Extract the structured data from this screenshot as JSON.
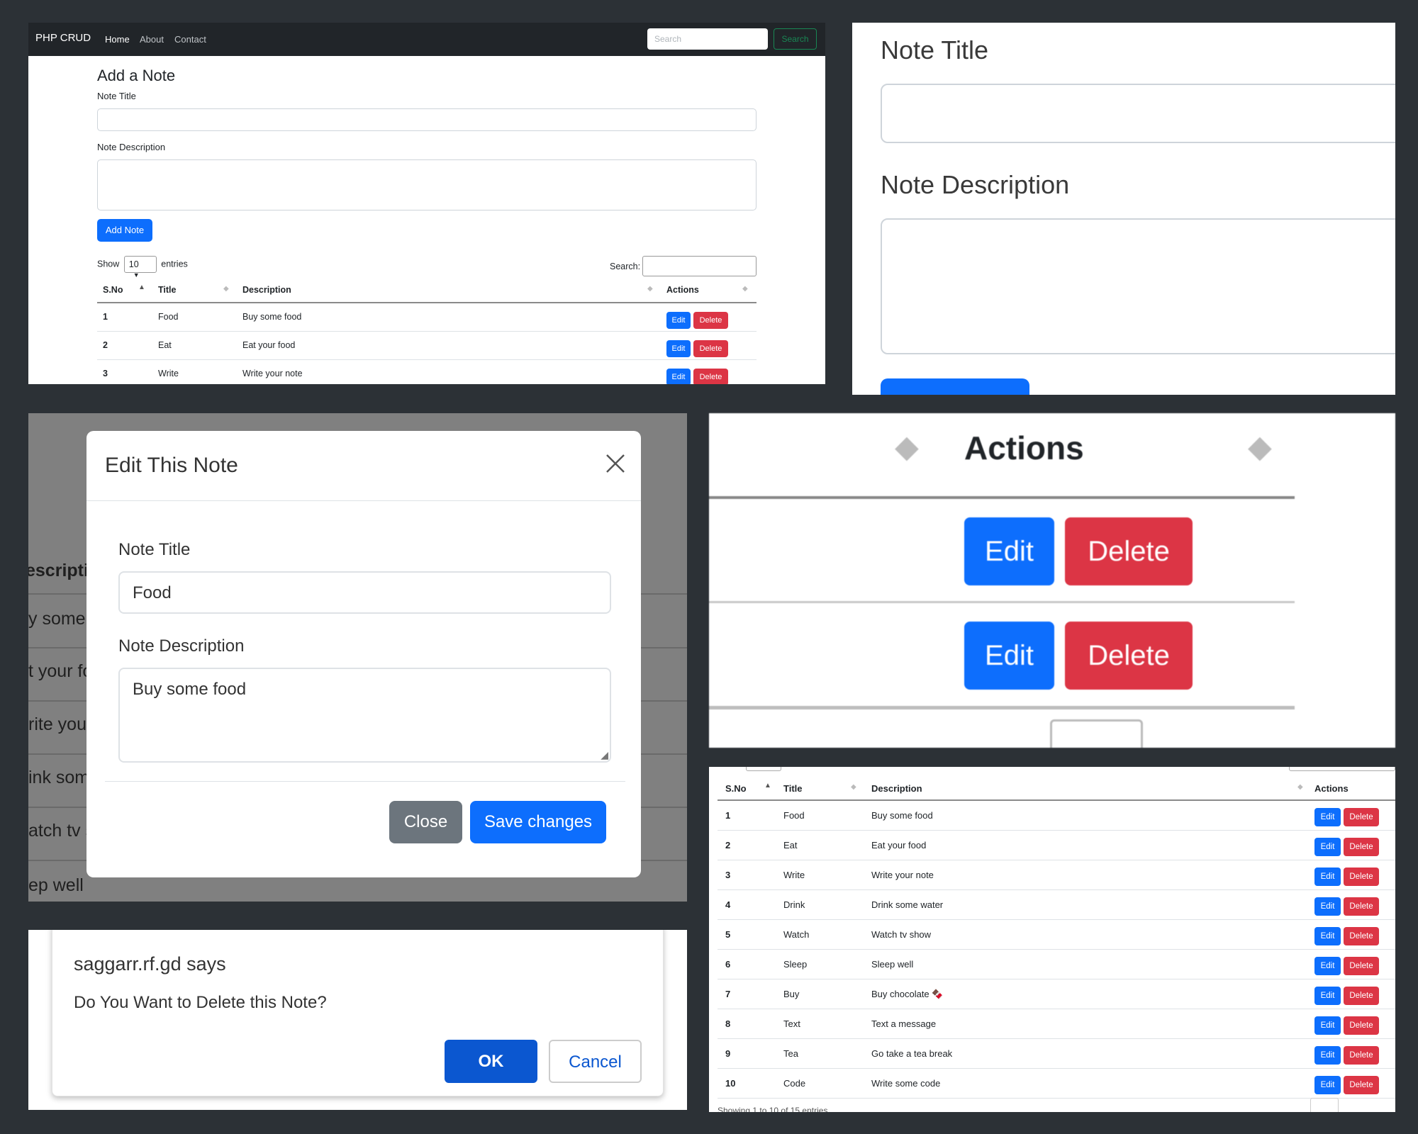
{
  "colors": {
    "primary": "#0d6efd",
    "danger": "#dc3545",
    "secondary": "#6c757d",
    "dark": "#212529",
    "backdrop": "#808080"
  },
  "navbar": {
    "brand": "PHP CRUD",
    "links": [
      "Home",
      "About",
      "Contact"
    ],
    "active_link": "Home",
    "search_placeholder": "Search",
    "search_button": "Search"
  },
  "add_form": {
    "heading": "Add a Note",
    "title_label": "Note Title",
    "desc_label": "Note Description",
    "submit_label": "Add Note"
  },
  "table_controls": {
    "show_label": "Show",
    "entries_value": "10",
    "entries_label": "entries",
    "search_label": "Search:"
  },
  "table": {
    "headers": [
      "S.No",
      "Title",
      "Description",
      "Actions"
    ],
    "edit_label": "Edit",
    "delete_label": "Delete",
    "rows": [
      {
        "sno": "1",
        "title": "Food",
        "desc": "Buy some food"
      },
      {
        "sno": "2",
        "title": "Eat",
        "desc": "Eat your food"
      },
      {
        "sno": "3",
        "title": "Write",
        "desc": "Write your note"
      },
      {
        "sno": "4",
        "title": "Drink",
        "desc": "Drink some water"
      },
      {
        "sno": "5",
        "title": "Watch",
        "desc": "Watch tv show"
      },
      {
        "sno": "6",
        "title": "Sleep",
        "desc": "Sleep well"
      },
      {
        "sno": "7",
        "title": "Buy",
        "desc": "Buy chocolate 🍫"
      },
      {
        "sno": "8",
        "title": "Text",
        "desc": "Text a message"
      },
      {
        "sno": "9",
        "title": "Tea",
        "desc": "Go take a tea break"
      },
      {
        "sno": "10",
        "title": "Code",
        "desc": "Write some code"
      }
    ]
  },
  "zoom_form": {
    "title_label": "Note Title",
    "desc_label": "Note Description"
  },
  "edit_modal": {
    "title": "Edit This Note",
    "title_label": "Note Title",
    "title_value": "Food",
    "desc_label": "Note Description",
    "desc_value": "Buy some food",
    "close_label": "Close",
    "save_label": "Save changes",
    "background_fragments": [
      "escriptio",
      "y some",
      "t your fo",
      "rite your",
      "ink som",
      "atch tv s",
      "ep well"
    ]
  },
  "zoom_actions": {
    "header": "Actions",
    "edit_label": "Edit",
    "delete_label": "Delete"
  },
  "confirm_dialog": {
    "origin": "saggarr.rf.gd says",
    "message": "Do You Want to Delete this Note?",
    "ok_label": "OK",
    "cancel_label": "Cancel"
  }
}
